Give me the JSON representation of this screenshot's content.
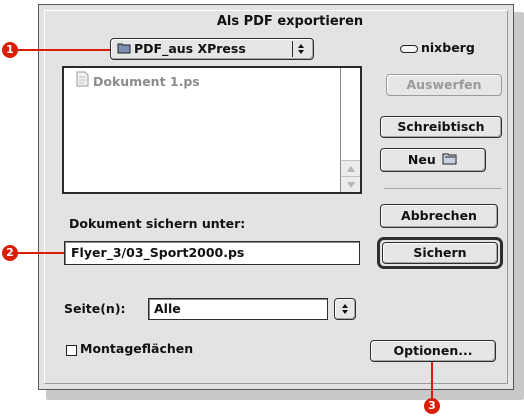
{
  "dialog": {
    "title": "Als PDF exportieren"
  },
  "folder_popup": {
    "value": "PDF_aus XPress",
    "icon": "folder-icon"
  },
  "volume": {
    "name": "nixberg",
    "icon": "drive-icon"
  },
  "file_list": {
    "items": [
      "Dokument 1.ps"
    ]
  },
  "buttons": {
    "eject": "Auswerfen",
    "desktop": "Schreibtisch",
    "new": "Neu",
    "cancel": "Abbrechen",
    "save": "Sichern",
    "options": "Optionen..."
  },
  "save_as": {
    "label": "Dokument sichern unter:",
    "value": "Flyer_3/03_Sport2000.ps"
  },
  "pages": {
    "label": "Seite(n):",
    "value": "Alle"
  },
  "checkbox": {
    "label": "Montageflächen",
    "checked": false
  },
  "callouts": [
    "1",
    "2",
    "3"
  ],
  "colors": {
    "callout": "#d81e05",
    "dialog_bg": "#e3e3e3"
  }
}
